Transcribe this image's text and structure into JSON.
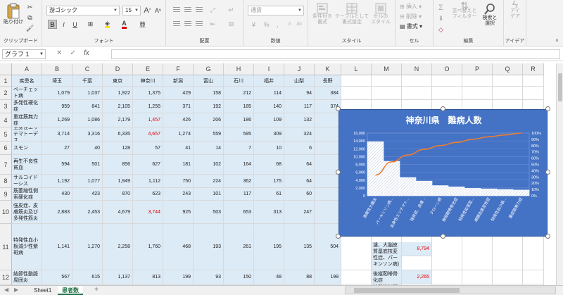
{
  "ribbon": {
    "clipboard": {
      "paste_label": "貼り付け",
      "group_label": "クリップボード"
    },
    "font": {
      "name": "游ゴシック",
      "size": "15",
      "grow": "A",
      "shrink": "A",
      "bold": "B",
      "italic": "I",
      "underline": "U",
      "group_label": "フォント"
    },
    "alignment": {
      "group_label": "配置"
    },
    "number": {
      "format": "通貨",
      "group_label": "数値"
    },
    "styles": {
      "cond_format": "条件付き\n書式",
      "table_format": "テーブルとして\n書式設定",
      "cell_style": "セルの\nスタイル",
      "group_label": "スタイル"
    },
    "cells": {
      "insert": "挿入",
      "delete": "削除",
      "format": "書式",
      "group_label": "セル"
    },
    "editing": {
      "sort_filter": "並べ替えと\nフィルター",
      "find_select": "検索と\n選択",
      "group_label": "編集"
    },
    "ideas": {
      "label": "アイ\nデア",
      "group_label": "アイデア"
    }
  },
  "formula_bar": {
    "name_box": "グラフ 1",
    "cancel": "✕",
    "enter": "✓",
    "fx": "fx",
    "value": ""
  },
  "columns": [
    "A",
    "B",
    "C",
    "D",
    "E",
    "F",
    "G",
    "H",
    "I",
    "J",
    "K",
    "L",
    "M",
    "N",
    "O",
    "P",
    "Q",
    "R"
  ],
  "rows": [
    "1",
    "2",
    "3",
    "4",
    "5",
    "6",
    "7",
    "8",
    "9",
    "10",
    "11",
    "12",
    "13"
  ],
  "table": {
    "headers": [
      "疾患名",
      "埼玉",
      "千葉",
      "東京",
      "神奈川",
      "新潟",
      "富山",
      "石川",
      "福井",
      "山梨",
      "長野"
    ],
    "data": [
      [
        "ベーチェット病",
        "1,079",
        "1,037",
        "1,922",
        "1,375",
        "429",
        "158",
        "212",
        "114",
        "94",
        "384"
      ],
      [
        "多発性硬化症",
        "959",
        "841",
        "2,105",
        "1,255",
        "371",
        "192",
        "185",
        "140",
        "117",
        "374"
      ],
      [
        "重症筋無力症",
        "1,269",
        "1,086",
        "2,179",
        "1,457",
        "426",
        "206",
        "186",
        "109",
        "132",
        ""
      ],
      [
        "全身性エリテマトーデス",
        "3,714",
        "3,316",
        "6,335",
        "4,657",
        "1,274",
        "559",
        "595",
        "309",
        "324",
        ""
      ],
      [
        "スモン",
        "27",
        "40",
        "128",
        "57",
        "41",
        "14",
        "7",
        "10",
        "6",
        ""
      ],
      [
        "再生不良性貧血",
        "594",
        "501",
        "856",
        "627",
        "181",
        "102",
        "164",
        "68",
        "64",
        ""
      ],
      [
        "サルコイドーシス",
        "1,192",
        "1,077",
        "1,949",
        "1,112",
        "750",
        "224",
        "362",
        "175",
        "64",
        ""
      ],
      [
        "筋萎縮性側索硬化症",
        "430",
        "423",
        "870",
        "623",
        "243",
        "101",
        "117",
        "61",
        "60",
        ""
      ],
      [
        "強皮症、皮膚筋炎及び多発性筋炎",
        "2,883",
        "2,453",
        "4,679",
        "3,744",
        "925",
        "503",
        "653",
        "313",
        "247",
        ""
      ],
      [
        "特発性血小板減少性紫斑病",
        "1,141",
        "1,270",
        "2,258",
        "1,760",
        "468",
        "193",
        "261",
        "195",
        "135",
        "504"
      ],
      [
        "結節性動脈周囲炎",
        "567",
        "615",
        "1,137",
        "813",
        "199",
        "93",
        "150",
        "48",
        "88",
        "199"
      ]
    ],
    "red_cells": [
      "3-4",
      "4-4",
      "9-4"
    ]
  },
  "side_cells": {
    "m11_text": "濾、大脳皮質基底核変性症、パーキンソン病)",
    "n11_value": "8,794",
    "m12_text": "後縦靭帯骨化症",
    "n12_value": "2,265",
    "m13_text": "特発性拡張型"
  },
  "chart_data": {
    "type": "bar",
    "title": "神奈川県　難病人数",
    "categories": [
      "潰瘍性大腸炎",
      "パーキンソン病...",
      "全身性エリテマト...",
      "強皮症、皮膚...",
      "クローン病",
      "後縦靭帯骨化症",
      "特発性拡張型...",
      "網膜色素変性症",
      "特発性血小板...",
      "重症筋無力症"
    ],
    "values": [
      13800,
      8794,
      4657,
      3744,
      2600,
      2265,
      1900,
      1760,
      1600,
      1457
    ],
    "cumulative_pct": [
      33,
      54,
      65,
      74,
      80,
      85,
      90,
      94,
      97,
      100
    ],
    "ylim": [
      0,
      16000
    ],
    "yticks": [
      "0",
      "2,000",
      "4,000",
      "6,000",
      "8,000",
      "10,000",
      "12,000",
      "14,000",
      "16,000"
    ],
    "y2ticks": [
      "0%",
      "10%",
      "20%",
      "30%",
      "40%",
      "50%",
      "60%",
      "70%",
      "80%",
      "90%",
      "100%"
    ],
    "colors": {
      "bg": "#4472c4",
      "bar": "#ffffff",
      "line": "#ed7d31"
    }
  },
  "sheet_tabs": {
    "sheets": [
      "Sheet1",
      "患者数"
    ],
    "active": "患者数",
    "add": "+"
  }
}
